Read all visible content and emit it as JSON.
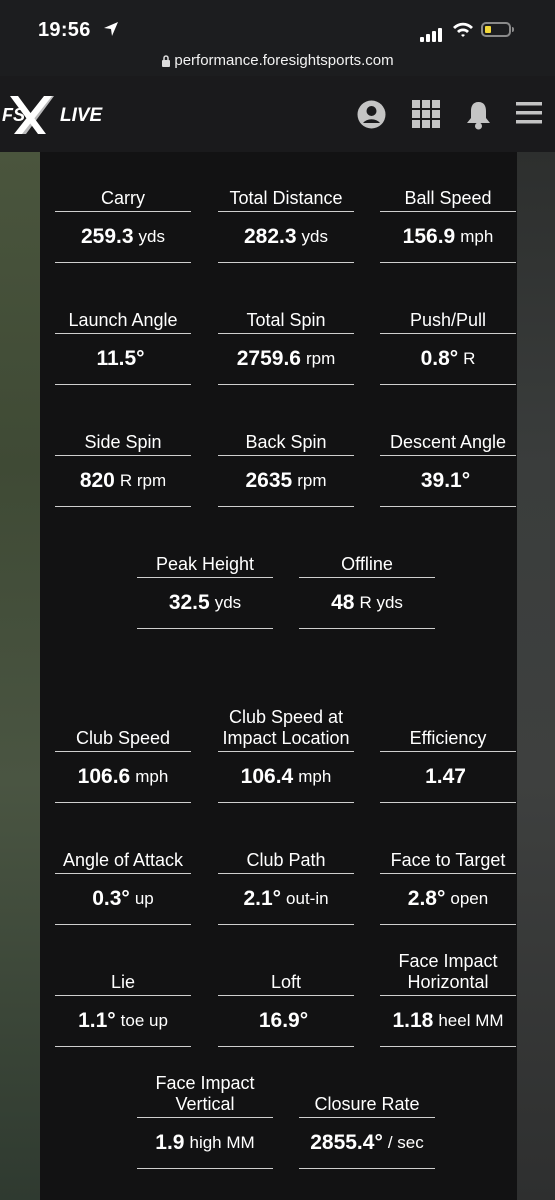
{
  "status_bar": {
    "time": "19:56"
  },
  "url": "performance.foresightsports.com",
  "brand": {
    "logo_text": "FSX LIVE"
  },
  "stats": [
    {
      "label": "Carry",
      "value": "259.3",
      "unit": "yds"
    },
    {
      "label": "Total Distance",
      "value": "282.3",
      "unit": "yds"
    },
    {
      "label": "Ball Speed",
      "value": "156.9",
      "unit": "mph"
    },
    {
      "label": "Launch Angle",
      "value": "11.5°",
      "unit": ""
    },
    {
      "label": "Total Spin",
      "value": "2759.6",
      "unit": "rpm"
    },
    {
      "label": "Push/Pull",
      "value": "0.8°",
      "unit": "R"
    },
    {
      "label": "Side Spin",
      "value": "820",
      "unit": "R rpm"
    },
    {
      "label": "Back Spin",
      "value": "2635",
      "unit": "rpm"
    },
    {
      "label": "Descent Angle",
      "value": "39.1°",
      "unit": ""
    },
    {
      "label": "Peak Height",
      "value": "32.5",
      "unit": "yds"
    },
    {
      "label": "Offline",
      "value": "48",
      "unit": "R yds"
    },
    {
      "label": "Club Speed",
      "value": "106.6",
      "unit": "mph"
    },
    {
      "label": "Club Speed at Impact Location",
      "value": "106.4",
      "unit": "mph"
    },
    {
      "label": "Efficiency",
      "value": "1.47",
      "unit": ""
    },
    {
      "label": "Angle of Attack",
      "value": "0.3°",
      "unit": "up"
    },
    {
      "label": "Club Path",
      "value": "2.1°",
      "unit": "out-in"
    },
    {
      "label": "Face to Target",
      "value": "2.8°",
      "unit": "open"
    },
    {
      "label": "Lie",
      "value": "1.1°",
      "unit": "toe up"
    },
    {
      "label": "Loft",
      "value": "16.9°",
      "unit": ""
    },
    {
      "label": "Face Impact Horizontal",
      "value": "1.18",
      "unit": "heel MM"
    },
    {
      "label": "Face Impact Vertical",
      "value": "1.9",
      "unit": "high MM"
    },
    {
      "label": "Closure Rate",
      "value": "2855.4°",
      "unit": "/ sec"
    }
  ]
}
